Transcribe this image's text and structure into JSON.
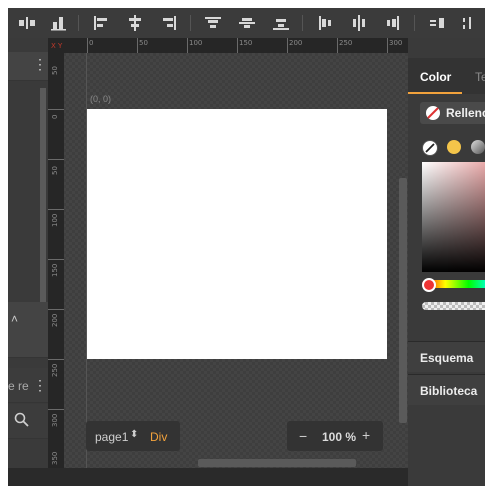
{
  "toolbar": {
    "icons": [
      "distribute-horizontal-icon",
      "distribute-vertical-icon",
      "align-left-icon",
      "align-center-horizontal-icon",
      "align-right-icon",
      "align-top-icon",
      "align-middle-vertical-icon",
      "align-bottom-icon",
      "distribute-left-icon",
      "distribute-center-icon",
      "distribute-right-icon",
      "space-horizontal-icon",
      "space-center-icon"
    ]
  },
  "canvas": {
    "ruler_top_labels": [
      "0",
      "50",
      "100",
      "150",
      "200",
      "250",
      "300"
    ],
    "ruler_left_labels": [
      "50",
      "0",
      "50",
      "100",
      "150",
      "200",
      "250",
      "300",
      "350"
    ],
    "ruler_corner": "X Y",
    "origin_label": "(0, 0)",
    "page_selector": "page1",
    "element_type": "Div",
    "zoom_value": "100 %",
    "zoom_minus": "−",
    "zoom_plus": "+"
  },
  "left_panel": {
    "partial_text": "e re",
    "search_icon": "search-icon",
    "collapse_icon": "chevron-up-icon"
  },
  "right_panel": {
    "tab_color": "Color",
    "tab_text": "Te",
    "fill_label": "Rellenc",
    "section_schema": "Esquema",
    "section_library": "Biblioteca",
    "swatch_colors": [
      "#ffffff",
      "#f4c54a",
      "#9a9a9a"
    ]
  },
  "colors": {
    "accent": "#f2a23c",
    "page": "#ffffff",
    "background": "#2f2f2f"
  }
}
